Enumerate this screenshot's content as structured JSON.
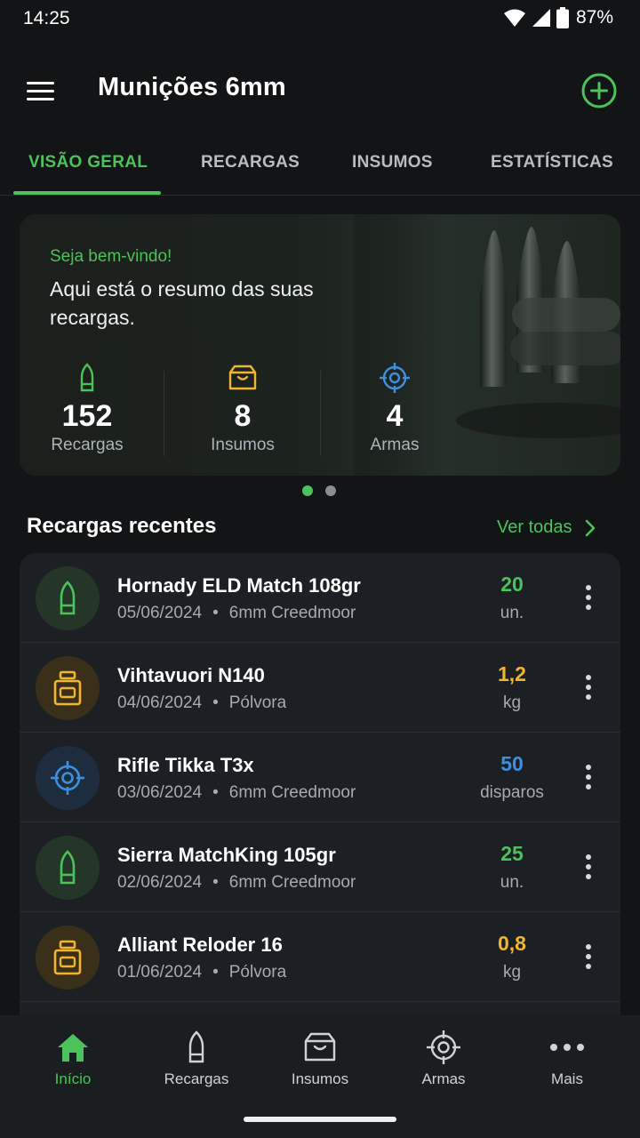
{
  "status_bar": {
    "time": "14:25",
    "battery": "87%"
  },
  "app_bar": {
    "title": "Munições 6mm"
  },
  "tabs": [
    {
      "label": "VISÃO GERAL"
    },
    {
      "label": "RECARGAS"
    },
    {
      "label": "INSUMOS"
    },
    {
      "label": "ESTATÍSTICAS"
    }
  ],
  "hero": {
    "welcome": "Seja bem-vindo!",
    "summary": "Aqui está o resumo das suas recargas.",
    "stats": [
      {
        "value": "152",
        "label": "Recargas",
        "icon": "bullet-icon"
      },
      {
        "value": "8",
        "label": "Insumos",
        "icon": "box-icon"
      },
      {
        "value": "4",
        "label": "Armas",
        "icon": "crosshair-icon"
      }
    ],
    "carousel": {
      "pages": 2,
      "active": 1
    }
  },
  "recent": {
    "title": "Recargas recentes",
    "see_all": "Ver todas",
    "items": [
      {
        "name": "Hornady ELD Match 108gr",
        "date": "05/06/2024",
        "category": "6mm Creedmoor",
        "qty": "20",
        "unit": "un.",
        "icon": "bullet-icon",
        "color": "#4cc25a"
      },
      {
        "name": "Vihtavuori N140",
        "date": "04/06/2024",
        "category": "Pólvora",
        "qty": "1,2",
        "unit": "kg",
        "icon": "powder-jar-icon",
        "color": "#f2b530"
      },
      {
        "name": "Rifle Tikka T3x",
        "date": "03/06/2024",
        "category": "6mm Creedmoor",
        "qty": "50",
        "unit": "disparos",
        "icon": "crosshair-icon",
        "color": "#3d8fe0"
      },
      {
        "name": "Sierra MatchKing 105gr",
        "date": "02/06/2024",
        "category": "6mm Creedmoor",
        "qty": "25",
        "unit": "un.",
        "icon": "bullet-icon",
        "color": "#4cc25a"
      },
      {
        "name": "Alliant Reloder 16",
        "date": "01/06/2024",
        "category": "Pólvora",
        "qty": "0,8",
        "unit": "kg",
        "icon": "powder-jar-icon",
        "color": "#f2b530"
      }
    ]
  },
  "bottom_nav": [
    {
      "label": "Início",
      "icon": "home-icon"
    },
    {
      "label": "Recargas",
      "icon": "bullet-icon"
    },
    {
      "label": "Insumos",
      "icon": "box-icon"
    },
    {
      "label": "Armas",
      "icon": "crosshair-icon"
    },
    {
      "label": "Mais",
      "icon": "more-icon"
    }
  ],
  "colors": {
    "accent": "#4cc25a",
    "powder": "#f2b530",
    "weapon": "#3d8fe0",
    "background": "#121416",
    "card": "#1c1f23"
  }
}
